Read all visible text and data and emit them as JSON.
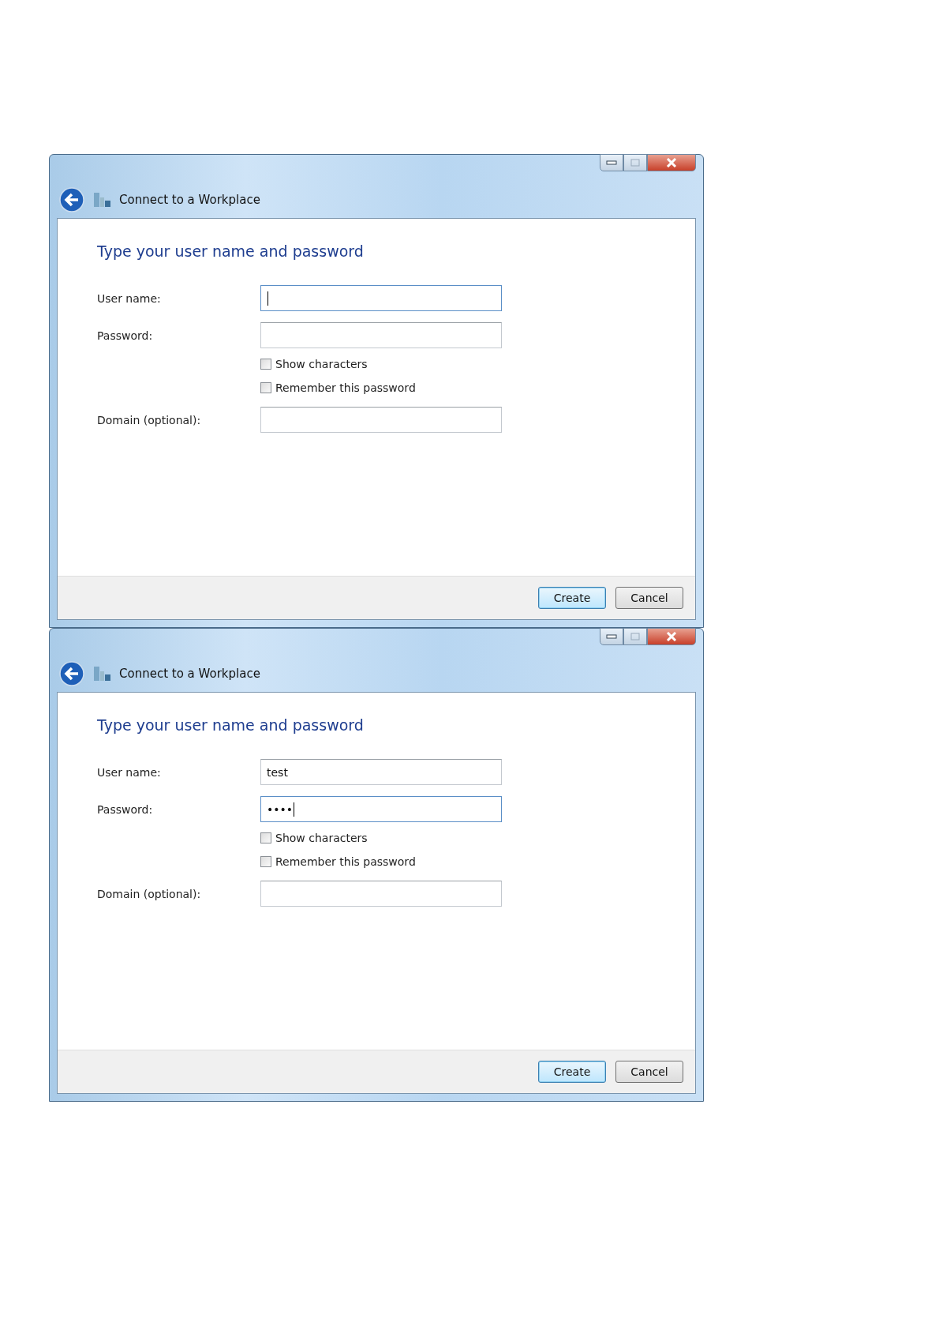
{
  "dialogs": [
    {
      "title": "Connect to a Workplace",
      "heading": "Type your user name and password",
      "fields": [
        {
          "label": "User name:",
          "focused": true
        },
        {
          "label": "Password:",
          "focused": false
        }
      ],
      "checkboxes": [
        {
          "label": "Show characters",
          "checked": false
        },
        {
          "label": "Remember this password",
          "checked": false
        }
      ],
      "domain": {
        "label": "Domain (optional):",
        "focused": false
      },
      "buttons": [
        {
          "label": "Create",
          "default": true
        },
        {
          "label": "Cancel",
          "default": false
        }
      ]
    },
    {
      "title": "Connect to a Workplace",
      "heading": "Type your user name and password",
      "fields": [
        {
          "label": "User name:",
          "value": "test",
          "focused": false
        },
        {
          "label": "Password:",
          "value": "••••",
          "focused": true
        }
      ],
      "checkboxes": [
        {
          "label": "Show characters",
          "checked": false
        },
        {
          "label": "Remember this password",
          "checked": false
        }
      ],
      "domain": {
        "label": "Domain (optional):",
        "focused": false
      },
      "buttons": [
        {
          "label": "Create",
          "default": true
        },
        {
          "label": "Cancel",
          "default": false
        }
      ]
    }
  ]
}
